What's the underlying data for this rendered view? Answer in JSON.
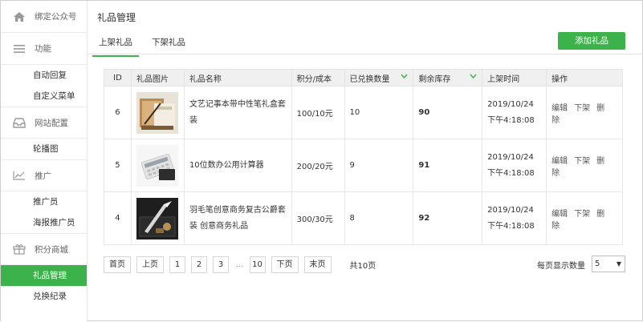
{
  "sidebar": {
    "top": "绑定公众号",
    "groups": [
      {
        "label": "功能",
        "items": [
          "自动回复",
          "自定义菜单"
        ]
      },
      {
        "label": "网站配置",
        "items": [
          "轮播图"
        ]
      },
      {
        "label": "推广",
        "items": [
          "推广员",
          "海报推广员"
        ]
      },
      {
        "label": "积分商城",
        "items": [
          "礼品管理",
          "兑换纪录"
        ]
      }
    ]
  },
  "page": {
    "title": "礼品管理"
  },
  "tabs": [
    "上架礼品",
    "下架礼品"
  ],
  "add_button": "添加礼品",
  "table": {
    "headers": [
      "ID",
      "礼品图片",
      "礼品名称",
      "积分/成本",
      "已兑换数量",
      "剩余库存",
      "上架时间",
      "操作"
    ],
    "rows": [
      {
        "id": "6",
        "name1": "文艺记事本带中性笔礼盒套",
        "name2": "装",
        "cost": "100/10元",
        "redeemed": "10",
        "stock": "90",
        "date": "2019/10/24",
        "time": "下午4:18:08"
      },
      {
        "id": "5",
        "name1": "10位数办公用计算器",
        "name2": "",
        "cost": "200/20元",
        "redeemed": "9",
        "stock": "91",
        "date": "2019/10/24",
        "time": "下午4:18:08"
      },
      {
        "id": "4",
        "name1": "羽毛笔创意商务复古公爵套",
        "name2": "装 创意商务礼品",
        "cost": "300/30元",
        "redeemed": "8",
        "stock": "92",
        "date": "2019/10/24",
        "time": "下午4:18:08"
      }
    ],
    "ops": [
      "编辑",
      "下架",
      "删除"
    ]
  },
  "pager": {
    "first": "首页",
    "prev": "上页",
    "pages": [
      "1",
      "2",
      "3"
    ],
    "dots": "...",
    "last_num": "10",
    "next": "下页",
    "last": "末页",
    "total": "共10页",
    "per_page_label": "每页显示数量",
    "per_page_value": "5"
  },
  "icons": {
    "home": "home-icon",
    "menu": "menu-icon",
    "inbox": "inbox-icon",
    "chart": "chart-icon",
    "gift": "gift-icon",
    "sort": "sort-down-icon"
  },
  "colors": {
    "accent": "#3cb34a",
    "stock": "#e23b30"
  }
}
